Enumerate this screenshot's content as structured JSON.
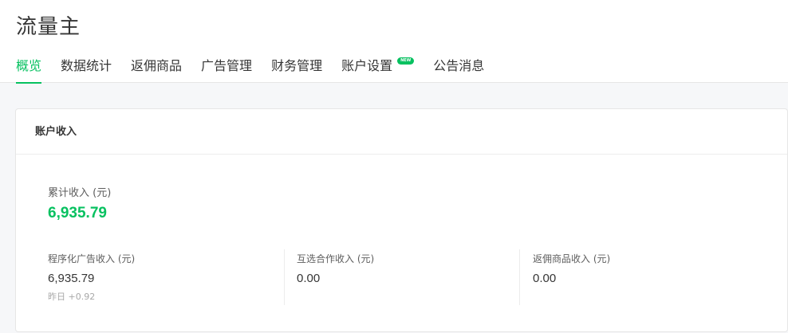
{
  "header": {
    "title": "流量主",
    "tabs": [
      {
        "label": "概览",
        "active": true
      },
      {
        "label": "数据统计",
        "active": false
      },
      {
        "label": "返佣商品",
        "active": false
      },
      {
        "label": "广告管理",
        "active": false
      },
      {
        "label": "财务管理",
        "active": false
      },
      {
        "label": "账户设置",
        "active": false,
        "badge": "NEW"
      },
      {
        "label": "公告消息",
        "active": false
      }
    ]
  },
  "income_card": {
    "title": "账户收入",
    "total": {
      "label": "累计收入 (元)",
      "value": "6,935.79"
    },
    "stats": [
      {
        "label": "程序化广告收入 (元)",
        "value": "6,935.79",
        "sub": "昨日 +0.92"
      },
      {
        "label": "互选合作收入 (元)",
        "value": "0.00"
      },
      {
        "label": "返佣商品收入 (元)",
        "value": "0.00"
      }
    ]
  },
  "colors": {
    "accent": "#07c160",
    "text": "#353535",
    "background": "#f6f7f9"
  }
}
